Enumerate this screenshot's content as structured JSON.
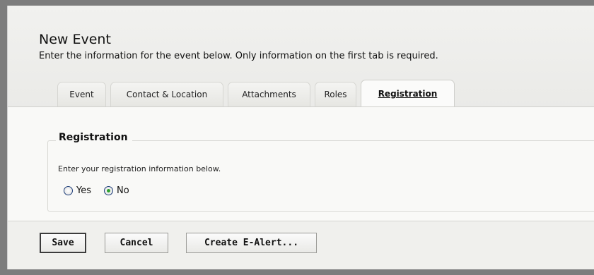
{
  "page": {
    "title": "New Event",
    "subtitle": "Enter the information for the event below. Only information on the first tab is required."
  },
  "tabs": [
    {
      "label": "Event"
    },
    {
      "label": "Contact & Location"
    },
    {
      "label": "Attachments"
    },
    {
      "label": "Roles"
    },
    {
      "label": "Registration",
      "active": true
    }
  ],
  "registration": {
    "legend": "Registration",
    "instructions": "Enter your registration information below.",
    "options": [
      {
        "label": "Yes",
        "selected": false
      },
      {
        "label": "No",
        "selected": true
      }
    ]
  },
  "buttons": {
    "save": "Save",
    "cancel": "Cancel",
    "create_alert": "Create E-Alert..."
  },
  "colors": {
    "accent_selected_radio": "#2fa12f",
    "radio_border": "#1f3f7a"
  }
}
